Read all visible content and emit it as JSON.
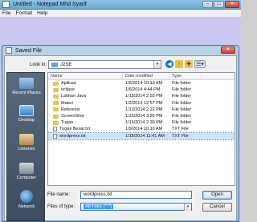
{
  "notepad": {
    "title": "Untitled - Notepad Mhd Syarif",
    "menus": [
      "File",
      "Format",
      "Help"
    ],
    "controls": {
      "minimize": "–",
      "maximize": "□",
      "close": "✕"
    }
  },
  "dialog": {
    "title": "Saved File",
    "close_glyph": "✕",
    "look_in_label": "Look in:",
    "look_in_value": "J2SE",
    "toolbar_glyphs": {
      "back": "◀",
      "up": "↑",
      "new_folder": "✚",
      "view": "☰▾"
    },
    "places": [
      "Recent Places",
      "Desktop",
      "Libraries",
      "Computer",
      "Network"
    ],
    "columns": {
      "name": "Name",
      "date": "Date modified",
      "type": "Type"
    },
    "files": [
      {
        "name": "Aplikasi",
        "date": "1/6/2014 10:19 AM",
        "type": "File folder",
        "kind": "folder"
      },
      {
        "name": "eclipse",
        "date": "1/6/2014 4:44 PM",
        "type": "File folder",
        "kind": "folder"
      },
      {
        "name": "Latihan Java",
        "date": "1/15/2014 2:55 PM",
        "type": "File folder",
        "kind": "folder"
      },
      {
        "name": "Materi",
        "date": "1/2/2014 12:57 PM",
        "type": "File folder",
        "kind": "folder"
      },
      {
        "name": "Referensi",
        "date": "1/13/2014 2:22 PM",
        "type": "File folder",
        "kind": "folder"
      },
      {
        "name": "ScreenShot",
        "date": "1/15/2014 3:55 PM",
        "type": "File folder",
        "kind": "folder"
      },
      {
        "name": "Tugas",
        "date": "1/15/2014 2:30 PM",
        "type": "File folder",
        "kind": "folder"
      },
      {
        "name": "Tugas Besar.txt",
        "date": "1/9/2014 10:10 AM",
        "type": "TXT File",
        "kind": "txt"
      },
      {
        "name": "wordpress.txt",
        "date": "1/15/2014 11:41 AM",
        "type": "TXT File",
        "kind": "txt",
        "selected": true
      }
    ],
    "file_name_label": "File name:",
    "file_name_value": "wordpress.txt",
    "files_of_type_label": "Files of type:",
    "files_of_type_value": "All Files (*.*)",
    "open_button": "Open",
    "cancel_button": "Cancel",
    "dropdown_arrow": "▾"
  }
}
